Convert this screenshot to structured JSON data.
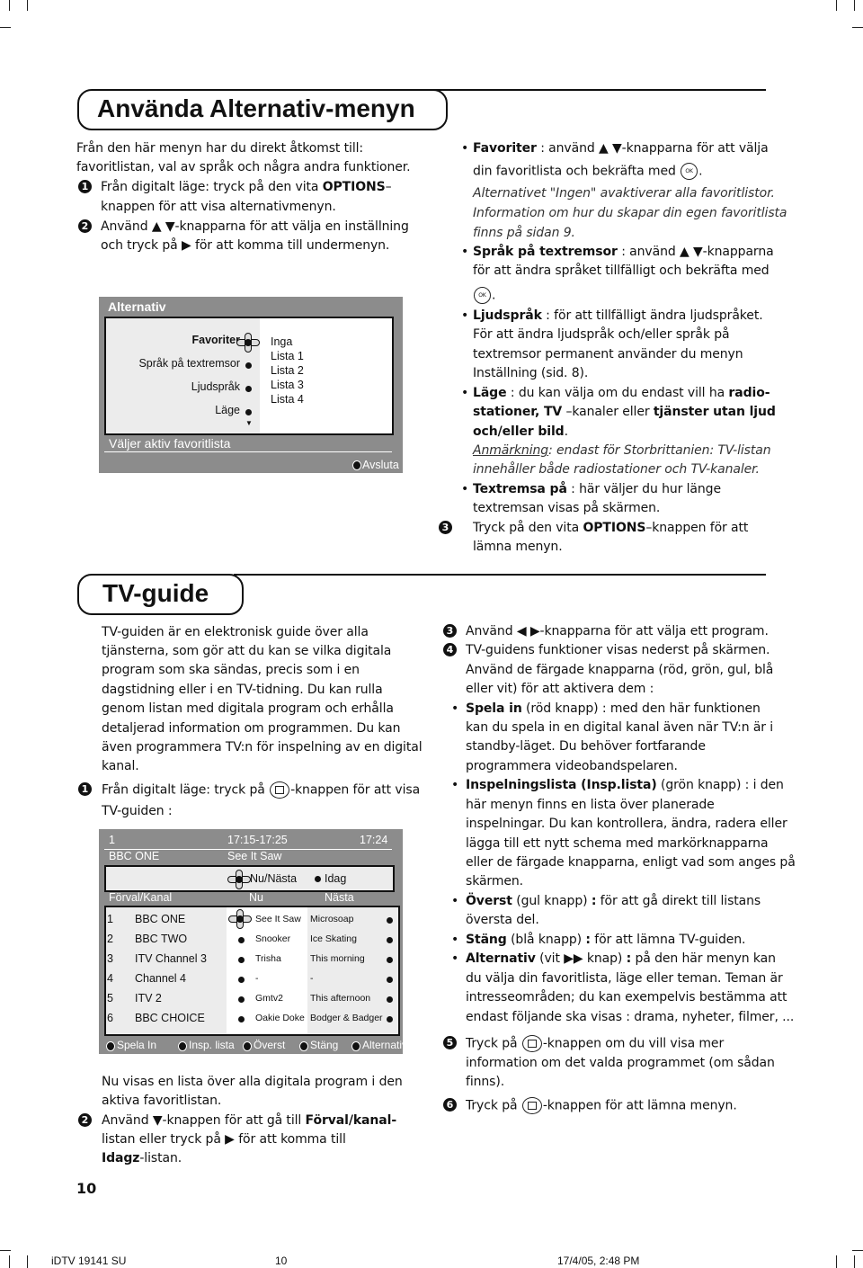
{
  "section1": {
    "title": "Använda Alternativ-menyn",
    "left": [
      [
        [
          "Från den här menyn har du direkt åtkomst till:"
        ]
      ],
      [
        [
          "favoritlistan, val av språk och några andra funktioner."
        ]
      ],
      [
        {
          "step": "1"
        },
        "Från digitalt läge: tryck på den vita ",
        {
          "b": "OPTIONS"
        },
        "–"
      ],
      [
        "knappen för att visa alternativmenyn."
      ],
      [
        {
          "step": "2"
        },
        "Använd ▲ ▼-knapparna för att välja en inställning"
      ],
      [
        "och tryck på ▶ för att komma till undermenyn."
      ]
    ],
    "right": [
      [
        {
          "bullet": "•"
        },
        {
          "b": "Favoriter"
        },
        " : använd ▲ ▼-knapparna för att välja"
      ],
      [
        "din favoritlista och bekräfta med ",
        {
          "icon": "ok-button-icon"
        },
        "."
      ],
      [
        {
          "i": "Alternativet \"Ingen\" avaktiverar alla favoritlistor."
        }
      ],
      [
        {
          "i": "Information om hur du skapar din egen favoritlista"
        }
      ],
      [
        {
          "i": "finns på sidan 9."
        }
      ],
      [
        {
          "bullet": "•"
        },
        {
          "b": "Språk på textremsor"
        },
        " : använd ▲ ▼-knapparna"
      ],
      [
        "för att ändra språket tillfälligt och bekräfta med"
      ],
      [
        {
          "icon": "ok-button-icon"
        },
        "."
      ],
      [
        {
          "bullet": "•"
        },
        {
          "b": "Ljudspråk"
        },
        " : för att tillfälligt ändra ljudspråket."
      ],
      [
        "För att ändra ljudspråk och/eller språk på"
      ],
      [
        "textremsor permanent använder du menyn"
      ],
      [
        "Inställning (sid. 8)."
      ],
      [
        {
          "bullet": "•"
        },
        {
          "b": "Läge"
        },
        " : du kan välja om du endast vill ha ",
        {
          "b": "radio-"
        }
      ],
      [
        {
          "b": "stationer, TV"
        },
        " –kanaler eller ",
        {
          "b": "tjänster utan ljud"
        }
      ],
      [
        {
          "b": "och/eller bild"
        },
        "."
      ],
      [
        {
          "u": "Anmärkning"
        },
        {
          "i": ": endast för Storbrittanien: TV-listan"
        }
      ],
      [
        {
          "i": "innehåller både radiostationer och TV-kanaler."
        }
      ],
      [
        {
          "bullet": "•"
        },
        {
          "b": "Textremsa på"
        },
        " :  här väljer du hur länge"
      ],
      [
        "textremsan visas på skärmen."
      ],
      [
        {
          "step": "3"
        },
        "Tryck på den vita ",
        {
          "b": "OPTIONS"
        },
        "–knappen för att"
      ],
      [
        "lämna menyn."
      ]
    ],
    "screen": {
      "title": "Alternativ",
      "items": [
        "Favoriter",
        "Språk på textremsor",
        "Ljudspråk",
        "Läge"
      ],
      "options": [
        "Inga",
        "Lista 1",
        "Lista 2",
        "Lista 3",
        "Lista 4"
      ],
      "status": "Väljer aktiv favoritlista",
      "exit": "Avsluta"
    }
  },
  "section2": {
    "title": "TV-guide",
    "left": [
      [
        "TV-guiden är en elektronisk guide över alla"
      ],
      [
        "tjänsterna, som gör att du kan se vilka digitala"
      ],
      [
        "program som ska sändas, precis som i en"
      ],
      [
        "dagstidning eller i en TV-tidning. Du kan rulla"
      ],
      [
        "genom listan med digitala program och erhålla"
      ],
      [
        "detaljerad information om programmen. Du kan"
      ],
      [
        "även programmera TV:n för inspelning av en digital"
      ],
      [
        "kanal."
      ],
      [
        {
          "step": "1"
        },
        "Från digitalt läge: tryck på ",
        {
          "icon": "guide-button-icon"
        },
        "-knappen för att visa"
      ],
      [
        "TV-guiden :"
      ],
      [
        "Nu visas en lista över alla digitala program i den"
      ],
      [
        "aktiva favoritlistan."
      ],
      [
        {
          "step": "2"
        },
        "Använd ▼-knappen för att gå till ",
        {
          "b": "Förval/kanal-"
        }
      ],
      [
        "listan eller tryck på ▶ för att komma till"
      ],
      [
        {
          "b": "Idagz"
        },
        "-listan."
      ]
    ],
    "right": [
      [
        {
          "step": "3"
        },
        "Använd ◀ ▶-knapparna för att välja ett program."
      ],
      [
        {
          "step": "4"
        },
        "TV-guidens funktioner visas nederst på skärmen."
      ],
      [
        "Använd de färgade knapparna (röd, grön, gul, blå"
      ],
      [
        "eller vit) för att aktivera dem :"
      ],
      [
        {
          "bullet": "•"
        },
        {
          "b": "Spela in"
        },
        " (röd knapp) : med den här funktionen"
      ],
      [
        "kan du spela in en digital kanal även när TV:n är i"
      ],
      [
        "standby-läget. Du behöver fortfarande"
      ],
      [
        "programmera videobandspelaren."
      ],
      [
        {
          "bullet": "•"
        },
        {
          "b": "Inspelningslista (Insp.lista)"
        },
        " (grön knapp) : i den"
      ],
      [
        "här menyn finns en lista över planerade"
      ],
      [
        "inspelningar. Du kan kontrollera, ändra, radera eller"
      ],
      [
        "lägga till ett nytt schema med markörknapparna"
      ],
      [
        "eller de färgade knapparna, enligt vad som anges på"
      ],
      [
        "skärmen."
      ],
      [
        {
          "bullet": "•"
        },
        {
          "b": "Överst"
        },
        " (gul knapp) ",
        {
          "b": ":"
        },
        " för att gå direkt till listans"
      ],
      [
        "översta del."
      ],
      [
        {
          "bullet": "•"
        },
        {
          "b": "Stäng"
        },
        " (blå knapp) ",
        {
          "b": ":"
        },
        " för att lämna TV-guiden."
      ],
      [
        {
          "bullet": "•"
        },
        {
          "b": "Alternativ"
        },
        " (vit ▶▶ knap) ",
        {
          "b": ":"
        },
        " på den här menyn kan"
      ],
      [
        "du välja din favoritlista, läge eller teman. Teman är"
      ],
      [
        "intresseområden; du kan exempelvis bestämma att"
      ],
      [
        "endast följande ska visas : drama, nyheter, filmer, ..."
      ],
      [
        {
          "step": "5"
        },
        "Tryck på ",
        {
          "icon": "guide-button-icon"
        },
        "-knappen om du vill visa mer"
      ],
      [
        "information om det valda programmet (om sådan"
      ],
      [
        "finns)."
      ],
      [
        {
          "step": "6"
        },
        "Tryck på ",
        {
          "icon": "guide-button-icon"
        },
        "-knappen för att lämna menyn."
      ]
    ],
    "screen": {
      "channel_num": "1",
      "time_range": "17:15-17:25",
      "clock": "17:24",
      "channel_name": "BBC ONE",
      "program": "See It Saw",
      "mode_now_next": "Nu/Nästa",
      "mode_today": "Idag",
      "col_channel": "Förval/Kanal",
      "col_now": "Nu",
      "col_next": "Nästa",
      "rows": [
        {
          "num": "1",
          "name": "BBC ONE",
          "now": "See It Saw",
          "next": "Microsoap"
        },
        {
          "num": "2",
          "name": "BBC TWO",
          "now": "Snooker",
          "next": "Ice Skating"
        },
        {
          "num": "3",
          "name": "ITV Channel 3",
          "now": "Trisha",
          "next": "This morning"
        },
        {
          "num": "4",
          "name": "Channel 4",
          "now": "-",
          "next": "-"
        },
        {
          "num": "5",
          "name": "ITV 2",
          "now": "Gmtv2",
          "next": "This afternoon"
        },
        {
          "num": "6",
          "name": "BBC CHOICE",
          "now": "Oakie Doke",
          "next": "Bodger & Badger"
        }
      ],
      "buttons": [
        "Spela In",
        "Insp. lista",
        "Överst",
        "Stäng",
        "Alternativ"
      ]
    }
  },
  "page_number": "10",
  "footer": {
    "doc": "iDTV 19141 SU",
    "page": "10",
    "date": "17/4/05, 2:48 PM"
  }
}
